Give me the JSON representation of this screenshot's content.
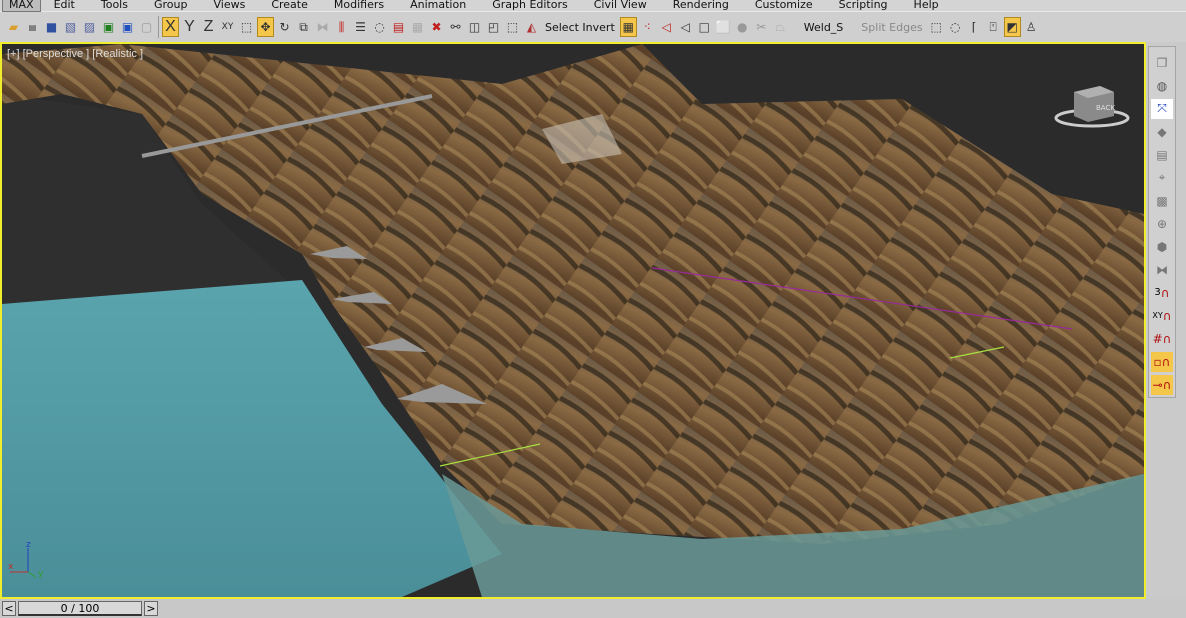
{
  "menu": [
    "MAX",
    "Edit",
    "Tools",
    "Group",
    "Views",
    "Create",
    "Modifiers",
    "Animation",
    "Graph Editors",
    "Civil View",
    "Rendering",
    "Customize",
    "Scripting",
    "Help"
  ],
  "toolbar": {
    "axis_x": "X",
    "axis_y": "Y",
    "axis_z": "Z",
    "axis_xy": "XY",
    "select_invert": "Select Invert",
    "weld": "Weld_S",
    "split_edges": "Split Edges"
  },
  "viewport": {
    "label": "[+] [Perspective ] [Realistic ]",
    "viewcube": "BACK",
    "axis": {
      "x": "x",
      "y": "y",
      "z": "z"
    }
  },
  "command_panel": {
    "snap3": "3",
    "snapxy": "XY"
  },
  "timeline": {
    "prev": "<",
    "frame": "0 / 100",
    "next": ">"
  },
  "colors": {
    "active_border": "#f0ee2c",
    "highlight": "#f4c64a",
    "water": "#4f9aa4"
  }
}
